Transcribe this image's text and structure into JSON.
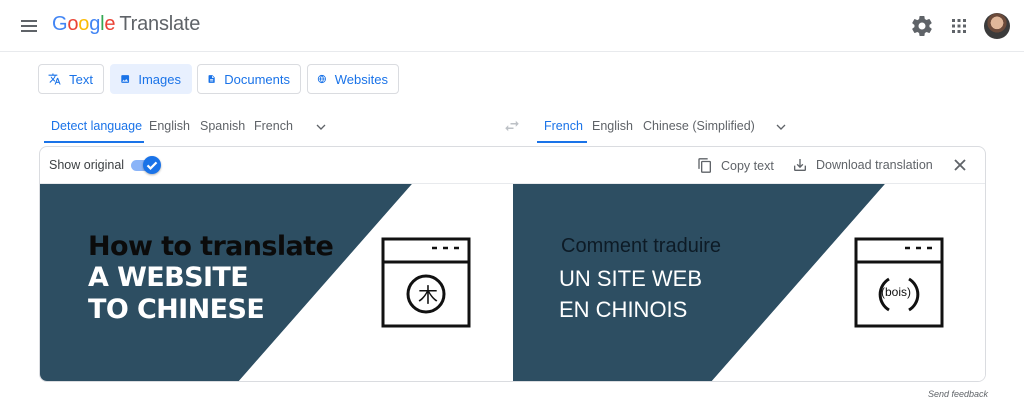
{
  "header": {
    "logo_letters": [
      "G",
      "o",
      "o",
      "g",
      "l",
      "e"
    ],
    "product": "Translate",
    "icons": [
      "menu-icon",
      "gear-icon",
      "apps-grid-icon",
      "avatar"
    ]
  },
  "modes": [
    {
      "label": "Text",
      "icon": "translate-icon",
      "active": false
    },
    {
      "label": "Images",
      "icon": "image-icon",
      "active": true
    },
    {
      "label": "Documents",
      "icon": "document-icon",
      "active": false
    },
    {
      "label": "Websites",
      "icon": "globe-icon",
      "active": false
    }
  ],
  "source_languages": [
    "Detect language",
    "English",
    "Spanish",
    "French"
  ],
  "target_languages": [
    "French",
    "English",
    "Chinese (Simplified)"
  ],
  "toolbar": {
    "show_original_label": "Show original",
    "show_original_on": true,
    "copy_text": "Copy text",
    "download": "Download translation"
  },
  "original_image": {
    "line1": "How to translate",
    "line2": "A WEBSITE",
    "line3": "TO CHINESE",
    "badge": "木"
  },
  "translated_image": {
    "line1": "Comment traduire",
    "line2": "UN SITE WEB",
    "line3": "EN CHINOIS",
    "badge": "(bois)"
  },
  "feedback": "Send feedback",
  "colors": {
    "accent": "#1a73e8",
    "image_dark": "#2d4e62"
  }
}
